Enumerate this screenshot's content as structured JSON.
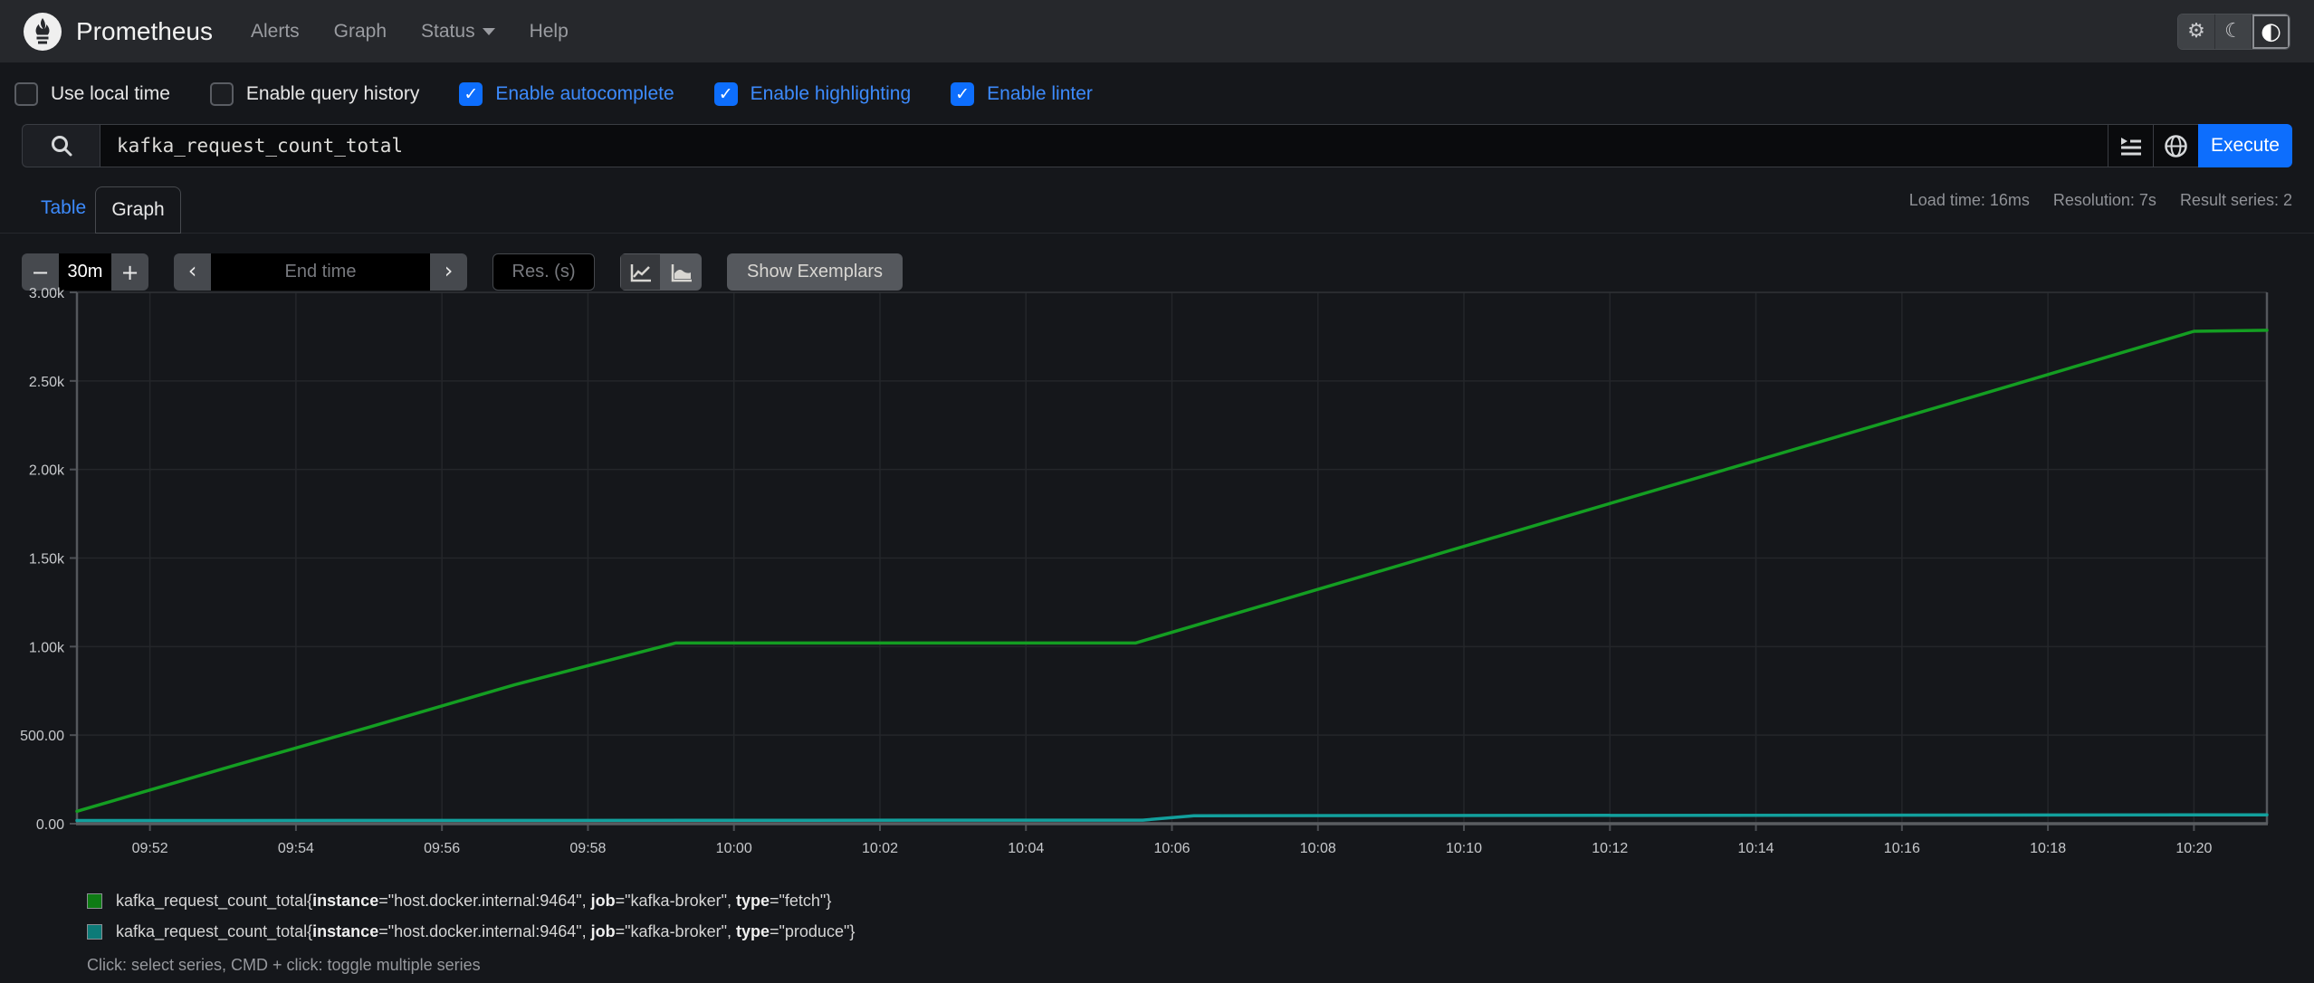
{
  "navbar": {
    "title": "Prometheus",
    "links": [
      {
        "label": "Alerts"
      },
      {
        "label": "Graph"
      },
      {
        "label": "Status",
        "dropdown": true
      },
      {
        "label": "Help"
      }
    ],
    "theme": {
      "light_icon": "⚙",
      "dark_icon": "☾",
      "auto_icon": "◐",
      "active": "auto"
    }
  },
  "options": {
    "checkboxes": [
      {
        "label": "Use local time",
        "checked": false
      },
      {
        "label": "Enable query history",
        "checked": false
      },
      {
        "label": "Enable autocomplete",
        "checked": true
      },
      {
        "label": "Enable highlighting",
        "checked": true
      },
      {
        "label": "Enable linter",
        "checked": true
      }
    ],
    "check_mark": "✓"
  },
  "query": {
    "value": "kafka_request_count_total",
    "execute_label": "Execute"
  },
  "tabs": {
    "table_label": "Table",
    "graph_label": "Graph"
  },
  "stats": {
    "load_time": "Load time: 16ms",
    "resolution": "Resolution: 7s",
    "result_series": "Result series: 2"
  },
  "controls": {
    "minus_label": "−",
    "plus_label": "+",
    "range_value": "30m",
    "chev_left": "‹",
    "chev_right": "›",
    "end_time_placeholder": "End time",
    "res_placeholder": "Res. (s)",
    "show_exemplars_label": "Show Exemplars"
  },
  "chart_data": {
    "type": "line",
    "title": "",
    "xlabel": "",
    "ylabel": "",
    "x_range_minutes": [
      0,
      30
    ],
    "x_origin_time": "09:51",
    "ylim": [
      0,
      3000
    ],
    "grid": true,
    "y_ticks": [
      {
        "v": 0,
        "label": "0.00"
      },
      {
        "v": 500,
        "label": "500.00"
      },
      {
        "v": 1000,
        "label": "1.00k"
      },
      {
        "v": 1500,
        "label": "1.50k"
      },
      {
        "v": 2000,
        "label": "2.00k"
      },
      {
        "v": 2500,
        "label": "2.50k"
      },
      {
        "v": 3000,
        "label": "3.00k"
      }
    ],
    "x_ticks": [
      {
        "m": 1,
        "label": "09:52"
      },
      {
        "m": 3,
        "label": "09:54"
      },
      {
        "m": 5,
        "label": "09:56"
      },
      {
        "m": 7,
        "label": "09:58"
      },
      {
        "m": 9,
        "label": "10:00"
      },
      {
        "m": 11,
        "label": "10:02"
      },
      {
        "m": 13,
        "label": "10:04"
      },
      {
        "m": 15,
        "label": "10:06"
      },
      {
        "m": 17,
        "label": "10:08"
      },
      {
        "m": 19,
        "label": "10:10"
      },
      {
        "m": 21,
        "label": "10:12"
      },
      {
        "m": 23,
        "label": "10:14"
      },
      {
        "m": 25,
        "label": "10:16"
      },
      {
        "m": 27,
        "label": "10:18"
      },
      {
        "m": 29,
        "label": "10:20"
      }
    ],
    "series": [
      {
        "name": "kafka_request_count_total type=fetch",
        "color": "#149e22",
        "points": [
          [
            0,
            70
          ],
          [
            2,
            310
          ],
          [
            4,
            545
          ],
          [
            6,
            785
          ],
          [
            8.2,
            1020
          ],
          [
            14.5,
            1020
          ],
          [
            17,
            1323
          ],
          [
            20,
            1687
          ],
          [
            23,
            2050
          ],
          [
            26,
            2414
          ],
          [
            29,
            2780
          ],
          [
            30,
            2786
          ]
        ]
      },
      {
        "name": "kafka_request_count_total type=produce",
        "color": "#12a09d",
        "points": [
          [
            0,
            18
          ],
          [
            14.6,
            20
          ],
          [
            15.3,
            45
          ],
          [
            30,
            50
          ]
        ]
      }
    ]
  },
  "legend": {
    "items": [
      {
        "swatch_color": "#0e7b14",
        "parts": [
          {
            "t": "kafka_request_count_total{",
            "b": false
          },
          {
            "t": "instance",
            "b": true
          },
          {
            "t": "=\"host.docker.internal:9464\", ",
            "b": false
          },
          {
            "t": "job",
            "b": true
          },
          {
            "t": "=\"kafka-broker\", ",
            "b": false
          },
          {
            "t": "type",
            "b": true
          },
          {
            "t": "=\"fetch\"}",
            "b": false
          }
        ]
      },
      {
        "swatch_color": "#0d7b78",
        "parts": [
          {
            "t": "kafka_request_count_total{",
            "b": false
          },
          {
            "t": "instance",
            "b": true
          },
          {
            "t": "=\"host.docker.internal:9464\", ",
            "b": false
          },
          {
            "t": "job",
            "b": true
          },
          {
            "t": "=\"kafka-broker\", ",
            "b": false
          },
          {
            "t": "type",
            "b": true
          },
          {
            "t": "=\"produce\"}",
            "b": false
          }
        ]
      }
    ],
    "note": "Click: select series, CMD + click: toggle multiple series"
  }
}
